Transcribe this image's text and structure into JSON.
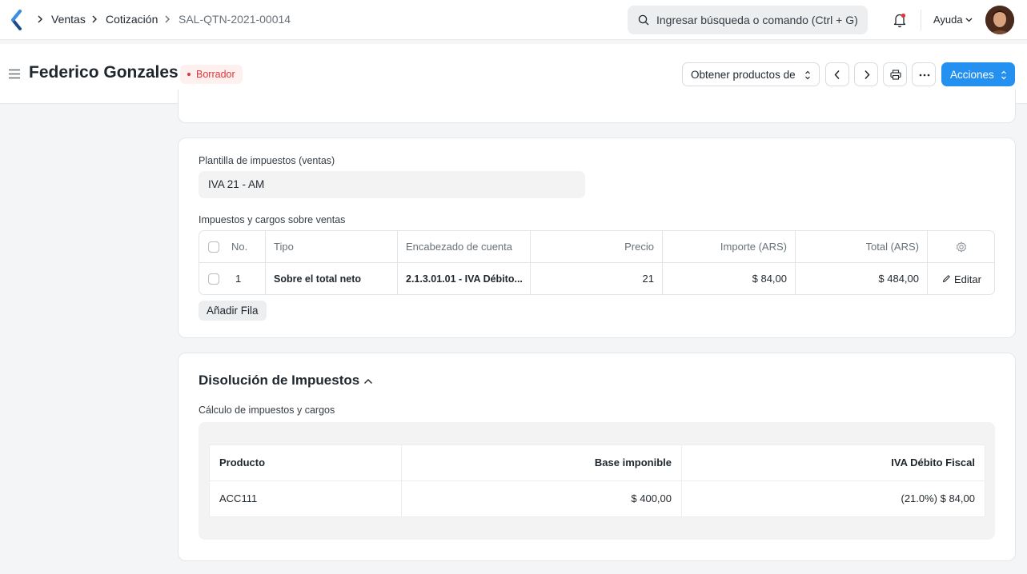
{
  "navbar": {
    "breadcrumbs": [
      "Ventas",
      "Cotización",
      "SAL-QTN-2021-00014"
    ],
    "search_placeholder": "Ingresar búsqueda o comando (Ctrl + G)",
    "help_label": "Ayuda"
  },
  "page": {
    "title": "Federico Gonzales",
    "status": "Borrador",
    "get_items_label": "Obtener productos de",
    "actions_label": "Acciones"
  },
  "taxes": {
    "template_label": "Plantilla de impuestos (ventas)",
    "template_value": "IVA 21 - AM",
    "table_label": "Impuestos y cargos sobre ventas",
    "columns": [
      "No.",
      "Tipo",
      "Encabezado de cuenta",
      "Precio",
      "Importe (ARS)",
      "Total (ARS)"
    ],
    "rows": [
      {
        "no": "1",
        "tipo": "Sobre el total neto",
        "cuenta": "2.1.3.01.01 - IVA Débito...",
        "precio": "21",
        "importe": "$ 84,00",
        "total": "$ 484,00",
        "edit": "Editar"
      }
    ],
    "add_row_label": "Añadir Fila"
  },
  "breakdown": {
    "title": "Disolución de Impuestos",
    "subtitle": "Cálculo de impuestos y cargos",
    "columns": [
      "Producto",
      "Base imponible",
      "IVA Débito Fiscal"
    ],
    "rows": [
      {
        "producto": "ACC111",
        "base": "$ 400,00",
        "iva": "(21.0%) $ 84,00"
      }
    ]
  },
  "colors": {
    "primary": "#2490ef",
    "draft": "#e03636",
    "background": "#f4f5f6"
  }
}
